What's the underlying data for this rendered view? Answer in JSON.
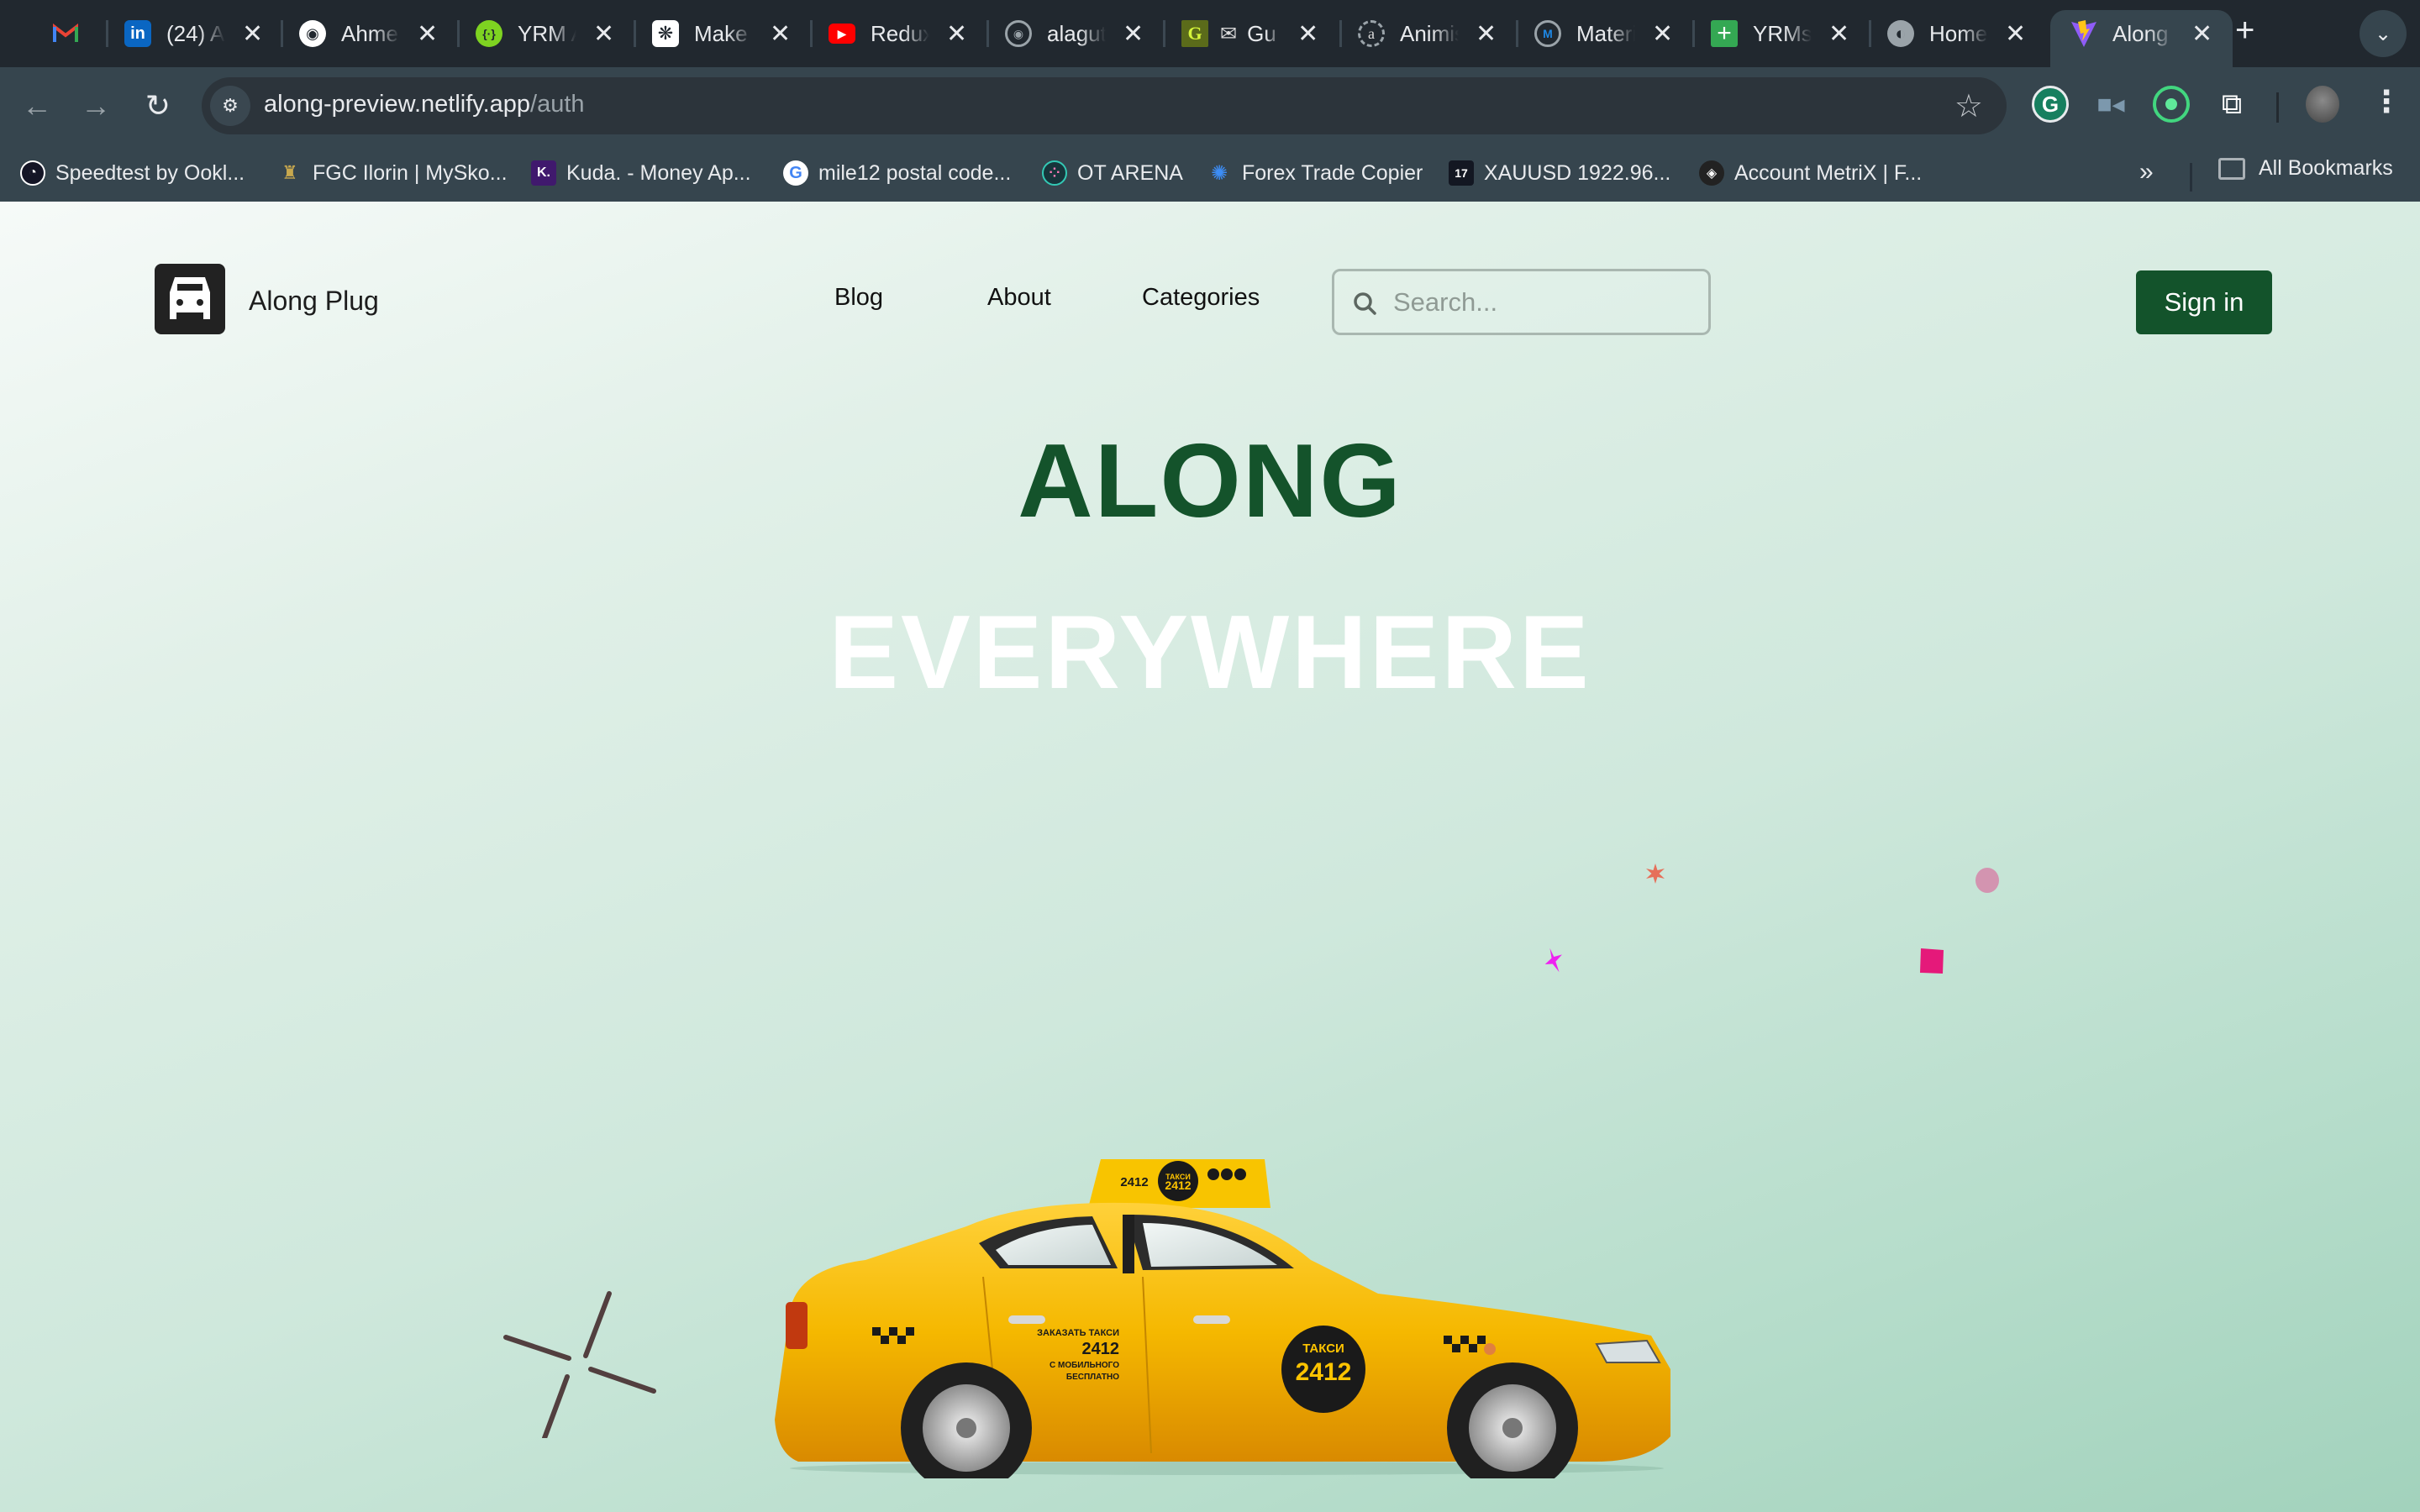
{
  "browser": {
    "tabs": [
      {
        "title": "Gmail",
        "icon": "gmail-icon",
        "color": "#ea4335",
        "pinned": true
      },
      {
        "title": "(24) A",
        "icon": "linkedin-icon",
        "color": "#0a66c2"
      },
      {
        "title": "Ahme",
        "icon": "github-icon",
        "color": "#ffffff"
      },
      {
        "title": "YRM A",
        "icon": "yrm-icon",
        "color": "#7ed321"
      },
      {
        "title": "Make",
        "icon": "openai-icon",
        "color": "#ffffff"
      },
      {
        "title": "Redux",
        "icon": "youtube-icon",
        "color": "#ff0000"
      },
      {
        "title": "alagut",
        "icon": "github-icon",
        "color": "#9aa3a9"
      },
      {
        "title": "Gu",
        "icon": "gumroad-icon",
        "color": "#c3e93a"
      },
      {
        "title": "Animis",
        "icon": "animista-icon",
        "color": "#9aa3a9"
      },
      {
        "title": "Materi",
        "icon": "material-icon",
        "color": "#1e88e5"
      },
      {
        "title": "YRMs",
        "icon": "sheets-icon",
        "color": "#34a853"
      },
      {
        "title": "Home",
        "icon": "globe-icon",
        "color": "#9aa3a9"
      },
      {
        "title": "Along",
        "icon": "vite-icon",
        "color": "#bd34fe",
        "active": true
      }
    ],
    "close_glyph": "✕",
    "new_tab_glyph": "+",
    "tab_search_glyph": "⌄",
    "url_host": "along-preview.netlify.app",
    "url_path": "/auth",
    "bookmarks": [
      {
        "label": "Speedtest by Ookl...",
        "icon": "speedtest-icon",
        "color": "#141526"
      },
      {
        "label": "FGC Ilorin | MySko...",
        "icon": "crest-icon",
        "color": "#2e7d32"
      },
      {
        "label": "Kuda. - Money Ap...",
        "icon": "kuda-icon",
        "color": "#40196d",
        "glyph": "K."
      },
      {
        "label": "mile12 postal code...",
        "icon": "google-icon",
        "color": "#ffffff",
        "glyph": "G"
      },
      {
        "label": "OT ARENA",
        "icon": "ot-arena-icon",
        "color": "#17353b"
      },
      {
        "label": "Forex Trade Copier",
        "icon": "forex-icon",
        "color": "#1e63d6"
      },
      {
        "label": "XAUUSD 1922.96...",
        "icon": "tradingview-icon",
        "color": "#131722",
        "glyph": "17"
      },
      {
        "label": "Account MetriX | F...",
        "icon": "metrix-icon",
        "color": "#222222"
      }
    ],
    "bookmarks_more": "»",
    "all_bookmarks": "All Bookmarks"
  },
  "site": {
    "brand": "Along Plug",
    "nav": [
      {
        "label": "Blog"
      },
      {
        "label": "About"
      },
      {
        "label": "Categories"
      }
    ],
    "search_placeholder": "Search...",
    "search_value": "",
    "sign_in": "Sign in",
    "hero_line1": "ALONG",
    "hero_line2": "EVERYWHERE",
    "taxi": {
      "roof_sign_number": "2412",
      "roof_sign_label": "ТАКСИ",
      "door_text": [
        "ЗАКАЗАТЬ ТАКСИ",
        "2412",
        "С МОБИЛЬНОГО",
        "БЕСПЛАТНО"
      ],
      "door_badge_label": "ТАКСИ",
      "door_badge_number": "2412"
    },
    "colors": {
      "brand_green": "#13532b",
      "hero_white": "#ffffff",
      "taxi_yellow": "#f5b800",
      "deco_star_orange": "#e6705a",
      "deco_circle_pink": "#d394b0",
      "deco_star_magenta": "#ee22f0",
      "deco_square_pink": "#e5197a",
      "deco_sparkle": "#523f3f"
    }
  }
}
